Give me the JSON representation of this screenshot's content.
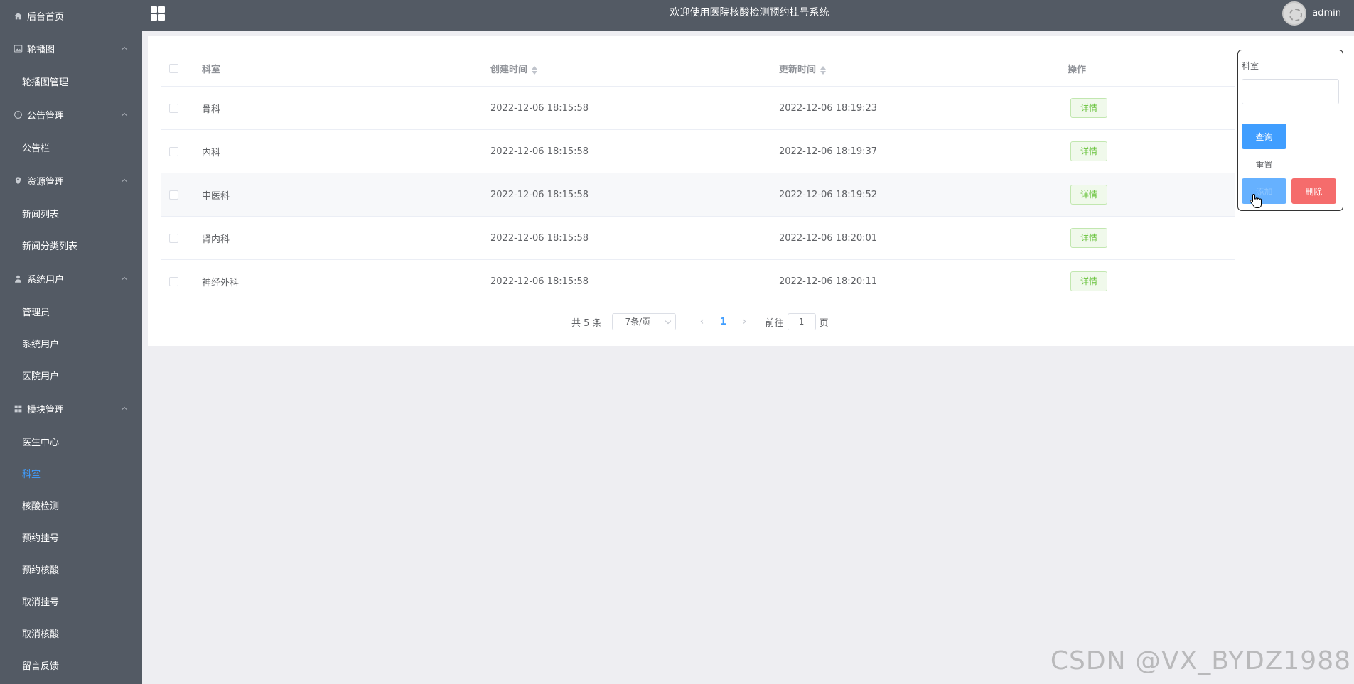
{
  "header": {
    "title": "欢迎使用医院核酸检测预约挂号系统",
    "username": "admin"
  },
  "sidebar": {
    "home": "后台首页",
    "groups": [
      {
        "label": "轮播图",
        "icon": "image-icon",
        "items": [
          "轮播图管理"
        ]
      },
      {
        "label": "公告管理",
        "icon": "info-icon",
        "items": [
          "公告栏"
        ]
      },
      {
        "label": "资源管理",
        "icon": "location-icon",
        "items": [
          "新闻列表",
          "新闻分类列表"
        ]
      },
      {
        "label": "系统用户",
        "icon": "user-icon",
        "items": [
          "管理员",
          "系统用户",
          "医院用户"
        ]
      },
      {
        "label": "模块管理",
        "icon": "grid-icon",
        "items": [
          "医生中心",
          "科室",
          "核酸检测",
          "预约挂号",
          "预约核酸",
          "取消挂号",
          "取消核酸",
          "留言反馈"
        ]
      }
    ],
    "active_item": "科室"
  },
  "table": {
    "columns": [
      "科室",
      "创建时间",
      "更新时间",
      "操作"
    ],
    "rows": [
      {
        "dept": "骨科",
        "created": "2022-12-06 18:15:58",
        "updated": "2022-12-06 18:19:23",
        "action": "详情"
      },
      {
        "dept": "内科",
        "created": "2022-12-06 18:15:58",
        "updated": "2022-12-06 18:19:37",
        "action": "详情"
      },
      {
        "dept": "中医科",
        "created": "2022-12-06 18:15:58",
        "updated": "2022-12-06 18:19:52",
        "action": "详情"
      },
      {
        "dept": "肾内科",
        "created": "2022-12-06 18:15:58",
        "updated": "2022-12-06 18:20:01",
        "action": "详情"
      },
      {
        "dept": "神经外科",
        "created": "2022-12-06 18:15:58",
        "updated": "2022-12-06 18:20:11",
        "action": "详情"
      }
    ]
  },
  "pagination": {
    "total": "共 5 条",
    "page_size": "7条/页",
    "prev": "‹",
    "next": "›",
    "current": "1",
    "goto_prefix": "前往",
    "goto_value": "1",
    "goto_suffix": "页"
  },
  "search": {
    "label": "科室",
    "query": "查询",
    "reset": "重置",
    "add": "添加",
    "delete": "删除"
  },
  "watermark": "CSDN @VX_BYDZ1988",
  "colors": {
    "sidebar_bg": "#535a64",
    "primary": "#409eff",
    "success": "#67c23a",
    "danger": "#f56c6c"
  }
}
